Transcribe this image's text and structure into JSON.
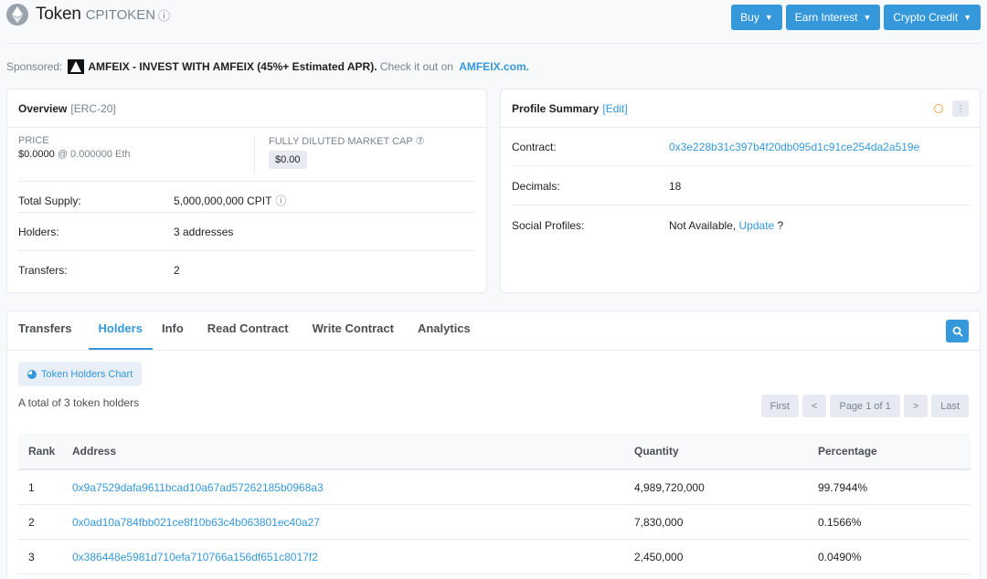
{
  "header": {
    "title": "Token",
    "symbol": "CPITOKEN",
    "info_glyph": "ⓘ",
    "buttons": [
      {
        "label": "Buy"
      },
      {
        "label": "Earn Interest"
      },
      {
        "label": "Crypto Credit"
      }
    ],
    "chevron": "⌄",
    "accent": "#3498db"
  },
  "sponsor": {
    "prefix": "Sponsored:",
    "bold": "AMFEIX - INVEST WITH AMFEIX (45%+ Estimated APR).",
    "middle": " Check it out on ",
    "link": "AMFEIX.com."
  },
  "overview": {
    "title": "Overview",
    "tag": "[ERC-20]",
    "price_label": "PRICE",
    "price_value": "$0.0000",
    "price_eth": "@ 0.000000 Eth",
    "cap_label": "FULLY DILUTED MARKET CAP",
    "cap_help": "⑦",
    "cap_value": "$0.00",
    "rows": [
      {
        "label": "Total Supply:",
        "value": "5,000,000,000 CPIT",
        "icon": "ⓘ"
      },
      {
        "label": "Holders:",
        "value": "3 addresses"
      },
      {
        "label": "Transfers:",
        "value": "2"
      }
    ]
  },
  "profile": {
    "title": "Profile Summary",
    "edit": "[Edit]",
    "more_glyph": "⋮",
    "rows": [
      {
        "label": "Contract:",
        "value": "0x3e228b31c397b4f20db095d1c91ce254da2a519e"
      },
      {
        "label": "Decimals:",
        "value": "18"
      },
      {
        "label": "Social Profiles:",
        "value": "Not Available, ",
        "link": "Update",
        "suffix": " ?"
      }
    ]
  },
  "tabs": [
    "Transfers",
    "Holders",
    "Info",
    "Read Contract",
    "Write Contract",
    "Analytics"
  ],
  "holders": {
    "chart_button": "Token Holders Chart",
    "total_text": "A total of 3 token holders",
    "pager": {
      "first": "First",
      "prev": "<",
      "page": "Page 1 of 1",
      "next": ">",
      "last": "Last"
    },
    "columns": [
      "Rank",
      "Address",
      "Quantity",
      "Percentage"
    ],
    "rows": [
      {
        "rank": "1",
        "address": "0x9a7529dafa9611bcad10a67ad57262185b0968a3",
        "quantity": "4,989,720,000",
        "percentage": "99.7944%"
      },
      {
        "rank": "2",
        "address": "0x0ad10a784fbb021ce8f10b63c4b063801ec40a27",
        "quantity": "7,830,000",
        "percentage": "0.1566%"
      },
      {
        "rank": "3",
        "address": "0x386448e5981d710efa710766a156df651c8017f2",
        "quantity": "2,450,000",
        "percentage": "0.0490%"
      }
    ]
  }
}
